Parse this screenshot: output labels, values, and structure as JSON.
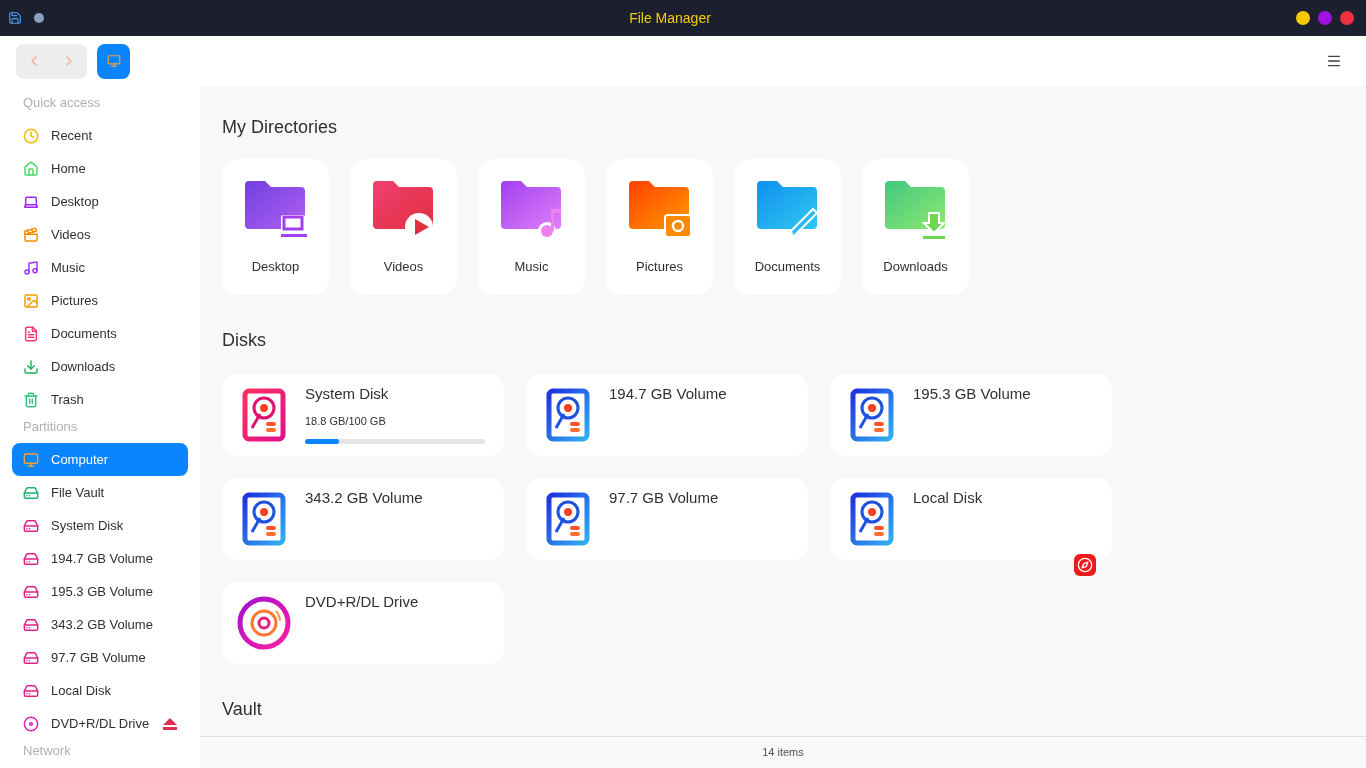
{
  "window": {
    "title": "File Manager"
  },
  "sidebar": {
    "sections": [
      {
        "title": "Quick access",
        "items": [
          {
            "label": "Recent",
            "kind": "recent",
            "selected": false
          },
          {
            "label": "Home",
            "kind": "home",
            "selected": false
          },
          {
            "label": "Desktop",
            "kind": "desktop",
            "selected": false
          },
          {
            "label": "Videos",
            "kind": "videos",
            "selected": false
          },
          {
            "label": "Music",
            "kind": "music",
            "selected": false
          },
          {
            "label": "Pictures",
            "kind": "pictures",
            "selected": false
          },
          {
            "label": "Documents",
            "kind": "documents",
            "selected": false
          },
          {
            "label": "Downloads",
            "kind": "downloads",
            "selected": false
          },
          {
            "label": "Trash",
            "kind": "trash",
            "selected": false
          }
        ]
      },
      {
        "title": "Partitions",
        "items": [
          {
            "label": "Computer",
            "kind": "computer",
            "selected": true
          },
          {
            "label": "File Vault",
            "kind": "vault",
            "selected": false
          },
          {
            "label": "System Disk",
            "kind": "disk",
            "selected": false
          },
          {
            "label": "194.7 GB Volume",
            "kind": "disk",
            "selected": false
          },
          {
            "label": "195.3 GB Volume",
            "kind": "disk",
            "selected": false
          },
          {
            "label": "343.2 GB Volume",
            "kind": "disk",
            "selected": false
          },
          {
            "label": "97.7 GB Volume",
            "kind": "disk",
            "selected": false
          },
          {
            "label": "Local Disk",
            "kind": "disk",
            "selected": false
          },
          {
            "label": "DVD+R/DL Drive",
            "kind": "optical",
            "selected": false,
            "ejectable": true
          }
        ]
      },
      {
        "title": "Network"
      }
    ]
  },
  "directories": {
    "title": "My Directories",
    "items": [
      {
        "label": "Desktop",
        "kind": "desktop"
      },
      {
        "label": "Videos",
        "kind": "videos"
      },
      {
        "label": "Music",
        "kind": "music"
      },
      {
        "label": "Pictures",
        "kind": "pictures"
      },
      {
        "label": "Documents",
        "kind": "documents"
      },
      {
        "label": "Downloads",
        "kind": "downloads"
      }
    ]
  },
  "disks": {
    "title": "Disks",
    "items": [
      {
        "name": "System Disk",
        "kind": "system",
        "usage": "18.8 GB/100 GB",
        "level": 0.19
      },
      {
        "name": "194.7 GB Volume",
        "kind": "hdd"
      },
      {
        "name": "195.3 GB Volume",
        "kind": "hdd"
      },
      {
        "name": "343.2 GB Volume",
        "kind": "hdd"
      },
      {
        "name": "97.7 GB Volume",
        "kind": "hdd"
      },
      {
        "name": "Local Disk",
        "kind": "hdd",
        "emblem": true
      },
      {
        "name": "DVD+R/DL Drive",
        "kind": "optical"
      }
    ]
  },
  "vault": {
    "title": "Vault"
  },
  "status_bar": {
    "text": "14 items"
  }
}
